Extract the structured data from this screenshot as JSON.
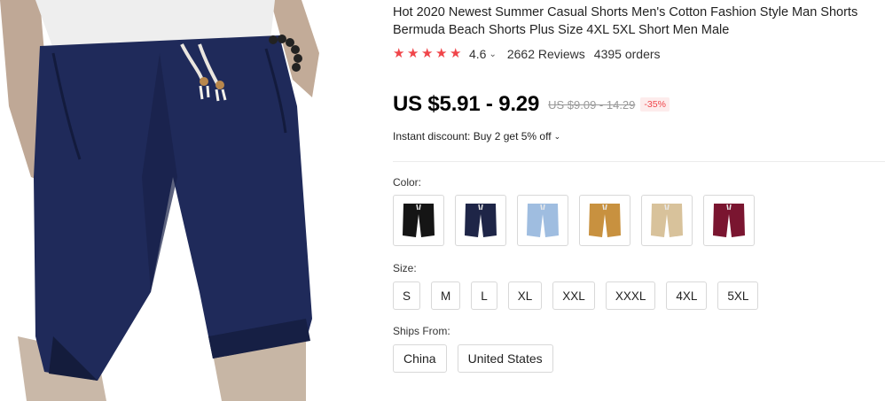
{
  "product": {
    "title": "Hot 2020 Newest Summer Casual Shorts Men's Cotton Fashion Style Man Shorts Bermuda Beach Shorts Plus Size 4XL 5XL Short Men Male",
    "rating": "4.6",
    "reviews": "2662 Reviews",
    "orders": "4395 orders",
    "price": "US $5.91 - 9.29",
    "original_price": "US $9.09 - 14.29",
    "discount": "-35%",
    "instant_discount": "Instant discount: Buy 2 get 5% off",
    "accent_color": "#f0454a"
  },
  "color_section": {
    "label": "Color:",
    "swatches": [
      {
        "name": "black",
        "hex": "#151515"
      },
      {
        "name": "navy",
        "hex": "#1e2547"
      },
      {
        "name": "light-blue",
        "hex": "#9fbde0"
      },
      {
        "name": "khaki",
        "hex": "#c8913f"
      },
      {
        "name": "beige",
        "hex": "#d8c29b"
      },
      {
        "name": "wine-red",
        "hex": "#7a1530"
      }
    ]
  },
  "size_section": {
    "label": "Size:",
    "options": [
      "S",
      "M",
      "L",
      "XL",
      "XXL",
      "XXXL",
      "4XL",
      "5XL"
    ]
  },
  "ships_section": {
    "label": "Ships From:",
    "options": [
      "China",
      "United States"
    ]
  }
}
